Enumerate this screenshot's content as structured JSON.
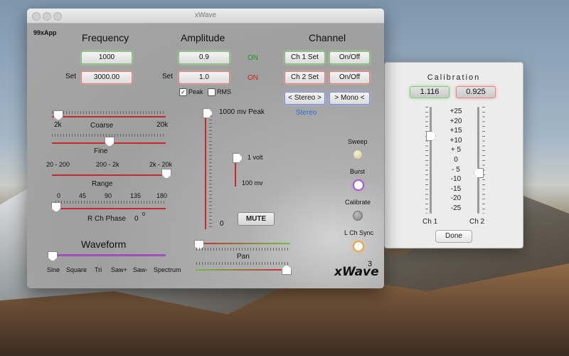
{
  "main_window": {
    "title": "xWave",
    "app_tag": "99xApp",
    "brand": "xWave",
    "brand_sup": "3"
  },
  "frequency": {
    "header": "Frequency",
    "value": "1000",
    "set_label": "Set",
    "set_value": "3000.00",
    "coarse": {
      "label": "Coarse",
      "min_label": "2k",
      "max_label": "20k",
      "position": 0.05
    },
    "fine": {
      "label": "Fine",
      "position": 0.5
    },
    "range": {
      "label": "Range",
      "options": [
        "20 - 200",
        "200 - 2k",
        "2k - 20k"
      ],
      "position": 1.0
    },
    "phase": {
      "label": "R Ch Phase",
      "ticks": [
        "0",
        "45",
        "90",
        "135",
        "180"
      ],
      "value": "0",
      "unit": "0",
      "position": 0.0
    }
  },
  "amplitude": {
    "header": "Amplitude",
    "value": "0.9",
    "value_state": "ON",
    "set_label": "Set",
    "set_value": "1.0",
    "set_state": "ON",
    "peak_label": "Peak",
    "peak_checked": true,
    "rms_label": "RMS",
    "rms_checked": false,
    "main_slider_label": "1000 mv  Peak",
    "main_slider_bottom": "0",
    "sub_slider_top": "1 volt",
    "sub_slider_bottom": "100 mv",
    "mute_label": "MUTE"
  },
  "channel": {
    "header": "Channel",
    "ch1_set": "Ch 1 Set",
    "ch1_onoff": "On/Off",
    "ch2_set": "Ch 2 Set",
    "ch2_onoff": "On/Off",
    "stereo_btn": "< Stereo >",
    "mono_btn": "> Mono <",
    "mode_status": "Stereo"
  },
  "toggles": {
    "sweep": "Sweep",
    "burst": "Burst",
    "calibrate": "Calibrate",
    "lch_sync": "L Ch Sync"
  },
  "waveform": {
    "header": "Waveform",
    "options": [
      "Sine",
      "Square",
      "Tri",
      "Saw+",
      "Saw-",
      "Spectrum"
    ],
    "position": 0.0
  },
  "pan": {
    "label": "Pan"
  },
  "calibration": {
    "title": "Calibration",
    "ch1_value": "1.116",
    "ch2_value": "0.925",
    "scale": [
      "+25",
      "+20",
      "+15",
      "+10",
      "+ 5",
      "0",
      "- 5",
      "-10",
      "-15",
      "-20",
      "-25"
    ],
    "ch1_label": "Ch 1",
    "ch2_label": "Ch 2",
    "done_label": "Done"
  },
  "colors": {
    "on_green": "#1a9e1a",
    "on_red": "#d02020",
    "stereo_blue": "#2d6fd6",
    "slider_red": "#c6282d",
    "waveform_purple": "#a04fb4"
  }
}
